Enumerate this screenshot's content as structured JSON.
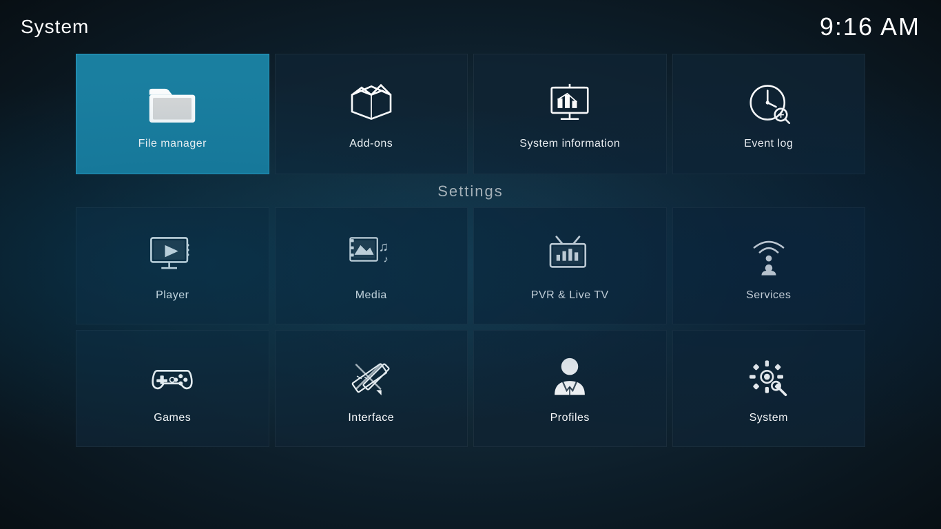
{
  "header": {
    "title": "System",
    "time": "9:16 AM"
  },
  "settings_label": "Settings",
  "top_tiles": [
    {
      "id": "file-manager",
      "label": "File manager",
      "icon": "folder",
      "active": true
    },
    {
      "id": "add-ons",
      "label": "Add-ons",
      "icon": "addons",
      "active": false
    },
    {
      "id": "system-information",
      "label": "System information",
      "icon": "sysinfo",
      "active": false
    },
    {
      "id": "event-log",
      "label": "Event log",
      "icon": "eventlog",
      "active": false
    }
  ],
  "settings_row1": [
    {
      "id": "player",
      "label": "Player",
      "icon": "player"
    },
    {
      "id": "media",
      "label": "Media",
      "icon": "media"
    },
    {
      "id": "pvr-live-tv",
      "label": "PVR & Live TV",
      "icon": "pvr"
    },
    {
      "id": "services",
      "label": "Services",
      "icon": "services"
    }
  ],
  "settings_row2": [
    {
      "id": "games",
      "label": "Games",
      "icon": "games"
    },
    {
      "id": "interface",
      "label": "Interface",
      "icon": "interface"
    },
    {
      "id": "profiles",
      "label": "Profiles",
      "icon": "profiles"
    },
    {
      "id": "system",
      "label": "System",
      "icon": "system"
    }
  ]
}
